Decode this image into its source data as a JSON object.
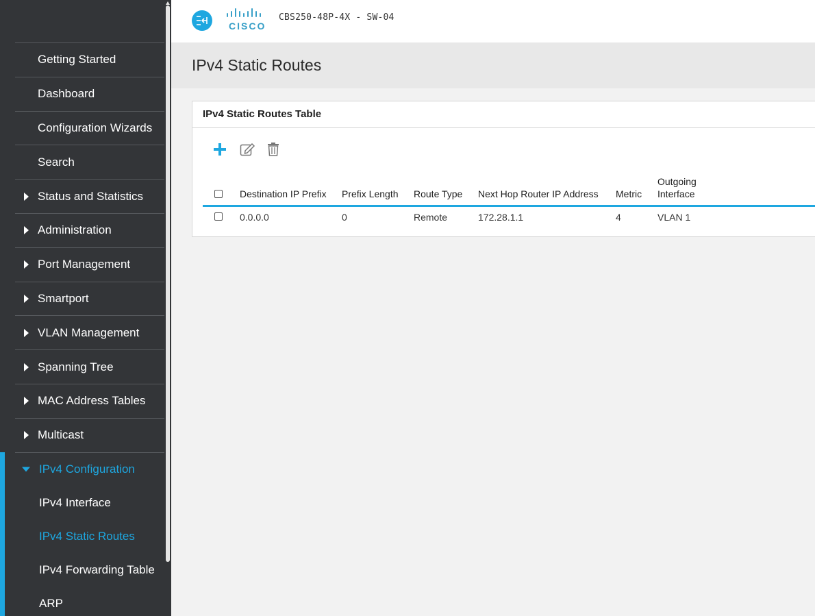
{
  "header": {
    "device_name": "CBS250-48P-4X - SW-04",
    "logo_text": "CISCO",
    "collapse_icon": "collapse-arrows-icon"
  },
  "sidebar": {
    "items": [
      {
        "label": "Getting Started",
        "expandable": false
      },
      {
        "label": "Dashboard",
        "expandable": false
      },
      {
        "label": "Configuration Wizards",
        "expandable": false
      },
      {
        "label": "Search",
        "expandable": false
      },
      {
        "label": "Status and Statistics",
        "expandable": true
      },
      {
        "label": "Administration",
        "expandable": true
      },
      {
        "label": "Port Management",
        "expandable": true
      },
      {
        "label": "Smartport",
        "expandable": true
      },
      {
        "label": "VLAN Management",
        "expandable": true
      },
      {
        "label": "Spanning Tree",
        "expandable": true
      },
      {
        "label": "MAC Address Tables",
        "expandable": true
      },
      {
        "label": "Multicast",
        "expandable": true
      },
      {
        "label": "IPv4 Configuration",
        "expandable": true,
        "expanded": true
      }
    ],
    "subitems": [
      {
        "label": "IPv4 Interface",
        "active": false
      },
      {
        "label": "IPv4 Static Routes",
        "active": true
      },
      {
        "label": "IPv4 Forwarding Table",
        "active": false
      },
      {
        "label": "ARP",
        "active": false
      }
    ]
  },
  "page": {
    "title": "IPv4 Static Routes"
  },
  "panel": {
    "title": "IPv4 Static Routes Table",
    "toolbar": {
      "add": "plus-icon",
      "edit": "edit-icon",
      "delete": "trash-icon"
    }
  },
  "table": {
    "columns": {
      "destination": "Destination IP Prefix",
      "prefix_length": "Prefix Length",
      "route_type": "Route Type",
      "next_hop": "Next Hop Router IP Address",
      "metric": "Metric",
      "outgoing_1": "Outgoing",
      "outgoing_2": "Interface"
    },
    "rows": [
      {
        "destination": "0.0.0.0",
        "prefix_length": "0",
        "route_type": "Remote",
        "next_hop": "172.28.1.1",
        "metric": "4",
        "outgoing": "VLAN 1"
      }
    ]
  },
  "colors": {
    "accent": "#1ea7e0",
    "sidebar_bg": "#333538",
    "logo": "#39a0c8"
  }
}
